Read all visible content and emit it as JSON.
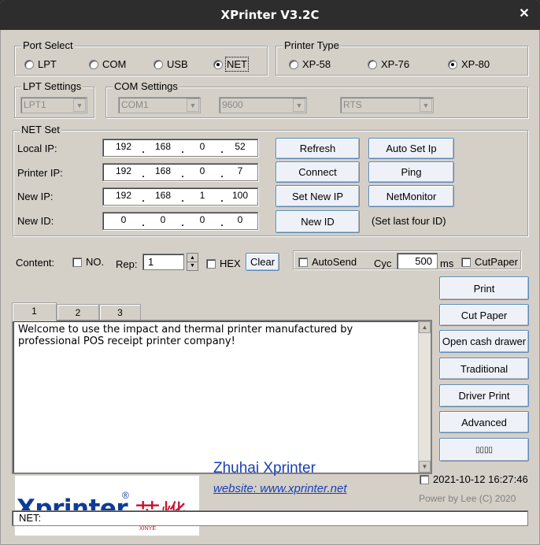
{
  "window": {
    "title": "XPrinter V3.2C"
  },
  "port_select": {
    "legend": "Port Select",
    "options": [
      "LPT",
      "COM",
      "USB",
      "NET"
    ],
    "selected": "NET"
  },
  "printer_type": {
    "legend": "Printer Type",
    "options": [
      "XP-58",
      "XP-76",
      "XP-80"
    ],
    "selected": "XP-80"
  },
  "lpt_settings": {
    "legend": "LPT Settings",
    "port": "LPT1"
  },
  "com_settings": {
    "legend": "COM Settings",
    "port": "COM1",
    "baud": "9600",
    "flow": "RTS"
  },
  "net_set": {
    "legend": "NET Set",
    "local_ip": {
      "label": "Local IP:",
      "octets": [
        "192",
        "168",
        "0",
        "52"
      ]
    },
    "printer_ip": {
      "label": "Printer IP:",
      "octets": [
        "192",
        "168",
        "0",
        "7"
      ]
    },
    "new_ip": {
      "label": "New IP:",
      "octets": [
        "192",
        "168",
        "1",
        "100"
      ]
    },
    "new_id": {
      "label": "New ID:",
      "octets": [
        "0",
        "0",
        "0",
        "0"
      ]
    },
    "buttons": {
      "refresh": "Refresh",
      "auto_set_ip": "Auto Set Ip",
      "connect": "Connect",
      "ping": "Ping",
      "set_new_ip": "Set New IP",
      "net_monitor": "NetMonitor",
      "new_id": "New ID"
    },
    "hint": "(Set last four ID)"
  },
  "content": {
    "label": "Content:",
    "no_label": "NO.",
    "rep_label": "Rep:",
    "rep_value": "1",
    "hex_label": "HEX",
    "clear_label": "Clear",
    "autosend_label": "AutoSend",
    "cyc_label": "Cyc",
    "cyc_value": "500",
    "ms_label": "ms",
    "cutpaper_label": "CutPaper"
  },
  "tabs": [
    "1",
    "2",
    "3"
  ],
  "text_area": "Welcome to use the impact and thermal printer manufactured by professional POS receipt printer company!",
  "right_buttons": {
    "print": "Print",
    "cut_paper": "Cut Paper",
    "open_cash_drawer": "Open cash drawer",
    "traditional": "Traditional",
    "driver_print": "Driver Print",
    "advanced": "Advanced",
    "unknown": "▯▯▯▯"
  },
  "logo": {
    "brand": "Xprinter",
    "registered": "®",
    "cjk": "芯烨",
    "sub": "XINYE"
  },
  "company": {
    "name": "Zhuhai Xprinter",
    "website": "website: www.xprinter.net"
  },
  "datetime": "2021-10-12 16:27:46",
  "power_by": "Power by Lee (C) 2020",
  "status_bar": "NET:",
  "colors": {
    "link": "#1a3fb5",
    "brand_blue": "#0c3c96",
    "brand_red": "#c8102e"
  }
}
